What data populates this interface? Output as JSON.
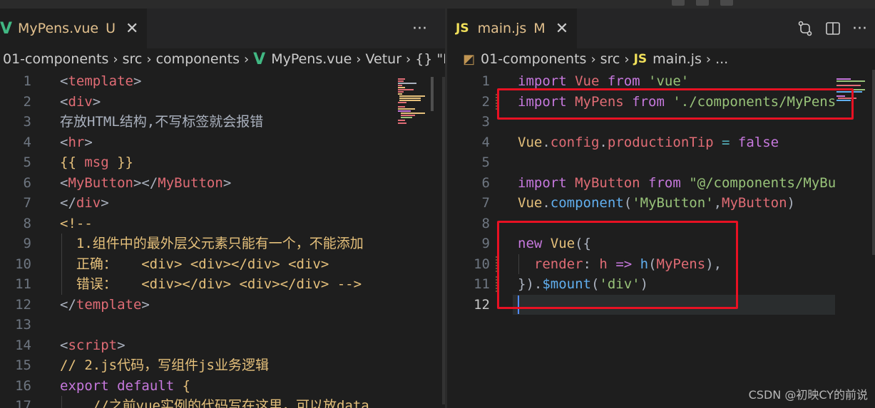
{
  "left": {
    "tab": {
      "filename": "MyPens.vue",
      "status": "U",
      "more": "···"
    },
    "breadcrumb": [
      "01-components",
      "src",
      "components",
      "MyPens.vue",
      "Vetur",
      "{} \"M"
    ],
    "lines": [
      {
        "n": "1",
        "tokens": [
          [
            "t-punc",
            "<"
          ],
          [
            "t-tag",
            "template"
          ],
          [
            "t-punc",
            ">"
          ]
        ]
      },
      {
        "n": "2",
        "tokens": [
          [
            "t-punc",
            "<"
          ],
          [
            "t-tag",
            "div"
          ],
          [
            "t-punc",
            ">"
          ]
        ]
      },
      {
        "n": "3",
        "tokens": [
          [
            "t-text",
            "存放HTML结构,不写标签就会报错"
          ]
        ]
      },
      {
        "n": "4",
        "tokens": [
          [
            "t-punc",
            "<"
          ],
          [
            "t-tag",
            "hr"
          ],
          [
            "t-punc",
            ">"
          ]
        ]
      },
      {
        "n": "5",
        "tokens": [
          [
            "t-brace",
            "{{ "
          ],
          [
            "t-var",
            "msg"
          ],
          [
            "t-brace",
            " }}"
          ]
        ]
      },
      {
        "n": "6",
        "tokens": [
          [
            "t-punc",
            "<"
          ],
          [
            "t-tag",
            "MyButton"
          ],
          [
            "t-punc",
            "></"
          ],
          [
            "t-tag",
            "MyButton"
          ],
          [
            "t-punc",
            ">"
          ]
        ]
      },
      {
        "n": "7",
        "tokens": [
          [
            "t-punc",
            "</"
          ],
          [
            "t-tag",
            "div"
          ],
          [
            "t-punc",
            ">"
          ]
        ]
      },
      {
        "n": "8",
        "tokens": [
          [
            "t-comment",
            "<!--"
          ]
        ]
      },
      {
        "n": "9",
        "tokens": [
          [
            "t-comment",
            "  1.组件中的最外层父元素只能有一个，不能添加"
          ]
        ]
      },
      {
        "n": "10",
        "tokens": [
          [
            "t-comment",
            "  正确：   <div> <div></div> <div>"
          ]
        ]
      },
      {
        "n": "11",
        "tokens": [
          [
            "t-comment",
            "  错误：   <div></div> <div></div> -->"
          ]
        ]
      },
      {
        "n": "12",
        "tokens": [
          [
            "t-punc",
            "</"
          ],
          [
            "t-tag",
            "template"
          ],
          [
            "t-punc",
            ">"
          ]
        ]
      },
      {
        "n": "13",
        "tokens": []
      },
      {
        "n": "14",
        "tokens": [
          [
            "t-punc",
            "<"
          ],
          [
            "t-tag",
            "script"
          ],
          [
            "t-punc",
            ">"
          ]
        ]
      },
      {
        "n": "15",
        "tokens": [
          [
            "t-js-comment",
            "// 2.js代码，写组件js业务逻辑"
          ]
        ]
      },
      {
        "n": "16",
        "tokens": [
          [
            "t-js-kw",
            "export default "
          ],
          [
            "t-brace",
            "{"
          ]
        ]
      },
      {
        "n": "17",
        "tokens": [
          [
            "t-js-comment",
            "    //之前vue实例的代码写在这里，可以放data"
          ]
        ]
      }
    ]
  },
  "right": {
    "tab": {
      "filename": "main.js",
      "status": "M"
    },
    "breadcrumb": [
      "01-components",
      "src",
      "main.js",
      "..."
    ],
    "lines": [
      {
        "n": "1",
        "tokens": [
          [
            "t-kw",
            "import "
          ],
          [
            "t-id",
            "Vue "
          ],
          [
            "t-kw",
            "from "
          ],
          [
            "t-str",
            "'vue'"
          ]
        ]
      },
      {
        "n": "2",
        "tokens": [
          [
            "t-kw",
            "import "
          ],
          [
            "t-id",
            "MyPens "
          ],
          [
            "t-kw",
            "from "
          ],
          [
            "t-str",
            "'./components/MyPens"
          ]
        ]
      },
      {
        "n": "3",
        "tokens": []
      },
      {
        "n": "4",
        "tokens": [
          [
            "t-obj",
            "Vue"
          ],
          [
            "t-punc",
            "."
          ],
          [
            "t-prop",
            "config"
          ],
          [
            "t-punc",
            "."
          ],
          [
            "t-prop",
            "productionTip "
          ],
          [
            "t-op",
            "= "
          ],
          [
            "t-kw",
            "false"
          ]
        ]
      },
      {
        "n": "5",
        "tokens": []
      },
      {
        "n": "6",
        "tokens": [
          [
            "t-kw",
            "import "
          ],
          [
            "t-id",
            "MyButton "
          ],
          [
            "t-kw",
            "from "
          ],
          [
            "t-str",
            "\"@/components/MyBu"
          ]
        ]
      },
      {
        "n": "7",
        "tokens": [
          [
            "t-obj",
            "Vue"
          ],
          [
            "t-punc",
            "."
          ],
          [
            "t-fn",
            "component"
          ],
          [
            "t-punc",
            "("
          ],
          [
            "t-str",
            "'MyButton'"
          ],
          [
            "t-punc",
            ","
          ],
          [
            "t-id",
            "MyButton"
          ],
          [
            "t-punc",
            ")"
          ]
        ]
      },
      {
        "n": "8",
        "tokens": []
      },
      {
        "n": "9",
        "tokens": [
          [
            "t-kw",
            "new "
          ],
          [
            "t-obj",
            "Vue"
          ],
          [
            "t-punc",
            "({"
          ]
        ]
      },
      {
        "n": "10",
        "tokens": [
          [
            "t-punc",
            "  "
          ],
          [
            "t-prop",
            "render"
          ],
          [
            "t-punc",
            ": "
          ],
          [
            "t-var",
            "h "
          ],
          [
            "t-kw",
            "=> "
          ],
          [
            "t-fn",
            "h"
          ],
          [
            "t-punc",
            "("
          ],
          [
            "t-id",
            "MyPens"
          ],
          [
            "t-punc",
            "),"
          ]
        ]
      },
      {
        "n": "11",
        "tokens": [
          [
            "t-punc",
            "})."
          ],
          [
            "t-fn",
            "$mount"
          ],
          [
            "t-punc",
            "("
          ],
          [
            "t-str",
            "'div'"
          ],
          [
            "t-punc",
            ")"
          ]
        ]
      },
      {
        "n": "12",
        "tokens": []
      }
    ]
  },
  "watermark": "CSDN @初映CY的前说",
  "colors": {
    "highlight": "#e81123",
    "vue": "#41b883",
    "js": "#f1e05a"
  }
}
